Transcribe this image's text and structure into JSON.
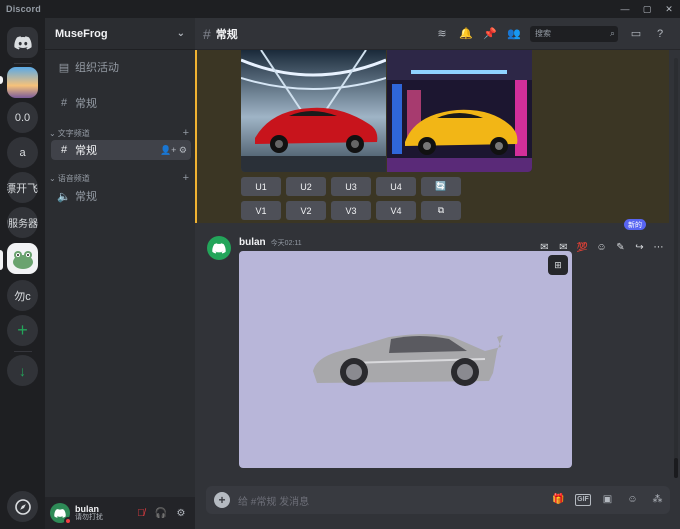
{
  "app": {
    "name": "Discord",
    "window_buttons": [
      "—",
      "▢",
      "✕"
    ]
  },
  "guilds": [
    {
      "label": "",
      "icon": "discord-logo-icon"
    },
    {
      "label": "",
      "icon": "landscape-avatar-icon"
    },
    {
      "label": "0.0"
    },
    {
      "label": "a"
    },
    {
      "label": "漂开飞"
    },
    {
      "label": "的服务器"
    },
    {
      "label": "",
      "icon": "frog-avatar-icon"
    },
    {
      "label": "勿c"
    },
    {
      "label": "+",
      "icon": "add-server-icon"
    },
    {
      "label": "↓",
      "icon": "download-icon"
    },
    {
      "label": "",
      "icon": "explore-icon"
    }
  ],
  "server": {
    "name": "MuseFrog"
  },
  "channels": {
    "events": "组织活动",
    "top_channel": "常规",
    "text_category": "文字频道",
    "text_channel": "常规",
    "voice_category": "语音频道",
    "voice_channel": "常规"
  },
  "user": {
    "name": "bulan",
    "status": "请勿打扰"
  },
  "header": {
    "channel": "常规",
    "search_placeholder": "搜索"
  },
  "midjourney_buttons": {
    "upscale": [
      "U1",
      "U2",
      "U3",
      "U4"
    ],
    "variation": [
      "V1",
      "V2",
      "V3",
      "V4"
    ],
    "reroll_icon": "refresh-icon",
    "web_icon": "external-link-icon"
  },
  "message": {
    "author": "bulan",
    "timestamp": "今天02:11"
  },
  "new_badge": "新的",
  "composer": {
    "placeholder": "给 #常规 发消息"
  },
  "colors": {
    "accent": "#5865f2",
    "online": "#23a55a",
    "dnd": "#f23f43",
    "highlight": "#f0b232",
    "image_bg": "#b8b6d9"
  }
}
